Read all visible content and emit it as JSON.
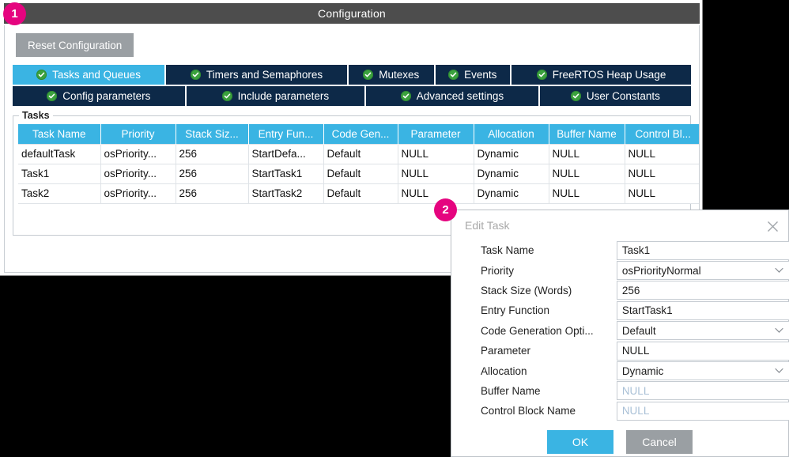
{
  "window": {
    "title": "Configuration",
    "reset_button": "Reset Configuration"
  },
  "tabs": {
    "row1": [
      {
        "label": "Tasks and Queues",
        "active": true
      },
      {
        "label": "Timers and Semaphores",
        "active": false
      },
      {
        "label": "Mutexes",
        "active": false
      },
      {
        "label": "Events",
        "active": false
      },
      {
        "label": "FreeRTOS Heap Usage",
        "active": false
      }
    ],
    "row2": [
      {
        "label": "Config parameters",
        "active": false
      },
      {
        "label": "Include parameters",
        "active": false
      },
      {
        "label": "Advanced settings",
        "active": false
      },
      {
        "label": "User Constants",
        "active": false
      }
    ]
  },
  "tasks_group": {
    "title": "Tasks",
    "columns": [
      "Task Name",
      "Priority",
      "Stack Siz...",
      "Entry Fun...",
      "Code Gen...",
      "Parameter",
      "Allocation",
      "Buffer Name",
      "Control Bl..."
    ],
    "rows": [
      [
        "defaultTask",
        "osPriority...",
        "256",
        "StartDefa...",
        "Default",
        "NULL",
        "Dynamic",
        "NULL",
        "NULL"
      ],
      [
        "Task1",
        "osPriority...",
        "256",
        "StartTask1",
        "Default",
        "NULL",
        "Dynamic",
        "NULL",
        "NULL"
      ],
      [
        "Task2",
        "osPriority...",
        "256",
        "StartTask2",
        "Default",
        "NULL",
        "Dynamic",
        "NULL",
        "NULL"
      ]
    ]
  },
  "dialog": {
    "title": "Edit Task",
    "close_icon": "close-icon",
    "fields": [
      {
        "label": "Task Name",
        "value": "Task1",
        "type": "text",
        "placeholder": false
      },
      {
        "label": "Priority",
        "value": "osPriorityNormal",
        "type": "select",
        "placeholder": false
      },
      {
        "label": "Stack Size (Words)",
        "value": "256",
        "type": "text",
        "placeholder": false
      },
      {
        "label": "Entry Function",
        "value": "StartTask1",
        "type": "text",
        "placeholder": false
      },
      {
        "label": "Code Generation Opti...",
        "value": "Default",
        "type": "select",
        "placeholder": false
      },
      {
        "label": "Parameter",
        "value": "NULL",
        "type": "text",
        "placeholder": false
      },
      {
        "label": "Allocation",
        "value": "Dynamic",
        "type": "select",
        "placeholder": false
      },
      {
        "label": "Buffer Name",
        "value": "NULL",
        "type": "text",
        "placeholder": true
      },
      {
        "label": "Control Block Name",
        "value": "NULL",
        "type": "text",
        "placeholder": true
      }
    ],
    "ok_label": "OK",
    "cancel_label": "Cancel"
  },
  "callouts": [
    {
      "number": "1"
    },
    {
      "number": "2"
    }
  ],
  "colors": {
    "accent_blue": "#3ab4e3",
    "tab_navy": "#0d2948",
    "titlebar_gray": "#4d4d4d",
    "button_gray": "#9a9fa3",
    "badge_pink": "#e5047f",
    "check_green": "#3ba23e",
    "placeholder_blue": "#a9c0d6"
  }
}
